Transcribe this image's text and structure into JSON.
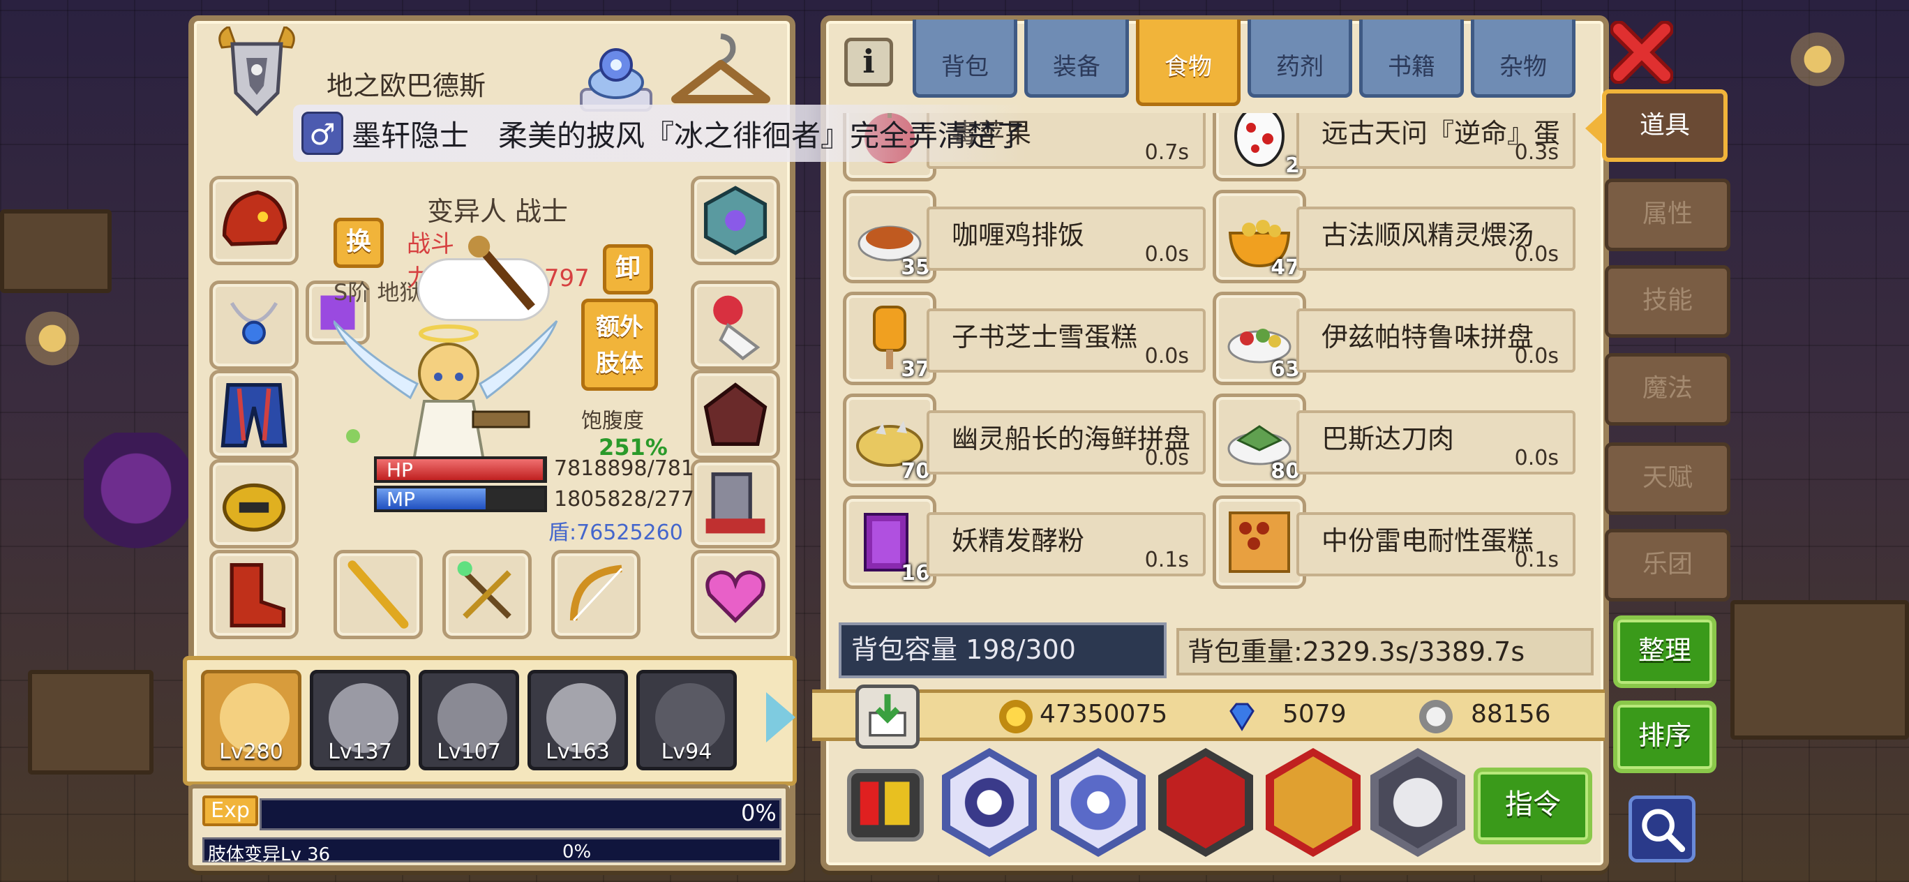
{
  "character": {
    "name": "地之欧巴德斯",
    "notice_gender": "♂",
    "notice_text": "墨轩隐士　柔美的披风『冰之徘徊者』完全弄清楚了",
    "race_class": "变异人 战士",
    "power": "战斗力:1037438797",
    "rank": "S阶 地狱使徒  Lv 100",
    "swap_label": "换",
    "unequip_label": "卸",
    "extra_limb_label": "额外肢体",
    "hunger_label": "饱腹度",
    "hunger_value": "251%",
    "hp_label": "HP",
    "hp_value": "7818898/781",
    "hp_fill": 0.99,
    "mp_label": "MP",
    "mp_value": "1805828/277",
    "mp_fill": 0.65,
    "shield": "盾:76525260"
  },
  "party": [
    {
      "level": "Lv280",
      "active": true
    },
    {
      "level": "Lv137",
      "active": false
    },
    {
      "level": "Lv107",
      "active": false
    },
    {
      "level": "Lv163",
      "active": false
    },
    {
      "level": "Lv94",
      "active": false
    }
  ],
  "exp": {
    "tag": "Exp",
    "pct": "0%",
    "sub_label": "肢体变异Lv 36",
    "sub_pct": "0%"
  },
  "inventory": {
    "info_icon": "i",
    "tabs": [
      "背包",
      "装备",
      "食物",
      "药剂",
      "书籍",
      "杂物"
    ],
    "active_tab": "食物",
    "items": [
      {
        "name": "毒苹果",
        "qty": "",
        "time": "0.7s",
        "icon": "apple-icon"
      },
      {
        "name": "远古天问『逆命』蛋",
        "qty": "2",
        "time": "0.3s",
        "icon": "spotted-egg-icon"
      },
      {
        "name": "咖喱鸡排饭",
        "qty": "35",
        "time": "0.0s",
        "icon": "curry-rice-icon"
      },
      {
        "name": "古法顺风精灵煨汤",
        "qty": "47",
        "time": "0.0s",
        "icon": "soup-bowl-icon"
      },
      {
        "name": "子书芝士雪蛋糕",
        "qty": "37",
        "time": "0.0s",
        "icon": "popsicle-icon"
      },
      {
        "name": "伊兹帕特鲁味拼盘",
        "qty": "63",
        "time": "0.0s",
        "icon": "platter-icon"
      },
      {
        "name": "幽灵船长的海鲜拼盘",
        "qty": "70",
        "time": "0.0s",
        "icon": "seafood-platter-icon"
      },
      {
        "name": "巴斯达刀肉",
        "qty": "80",
        "time": "0.0s",
        "icon": "meat-plate-icon"
      },
      {
        "name": "妖精发酵粉",
        "qty": "16",
        "time": "0.1s",
        "icon": "powder-bag-icon"
      },
      {
        "name": "中份雷电耐性蛋糕",
        "qty": "",
        "time": "0.1s",
        "icon": "cake-box-icon"
      }
    ],
    "capacity": "背包容量 198/300",
    "weight": "背包重量:2329.3s/3389.7s"
  },
  "currency": {
    "gold": "47350075",
    "diamond": "5079",
    "silver": "88156"
  },
  "toolbar": {
    "command_label": "指令"
  },
  "side_menu": {
    "items": [
      "道具",
      "属性",
      "技能",
      "魔法",
      "天赋",
      "乐团"
    ],
    "active": "道具",
    "organize_label": "整理",
    "sort_label": "排序"
  },
  "colors": {
    "panel_bg": "#efe3c6",
    "tab_active": "#f1b43a",
    "tab_inactive": "#6f8cb4",
    "green_button": "#3a9a1a",
    "power_red": "#d64040",
    "hunger_green": "#2a9a2a"
  }
}
